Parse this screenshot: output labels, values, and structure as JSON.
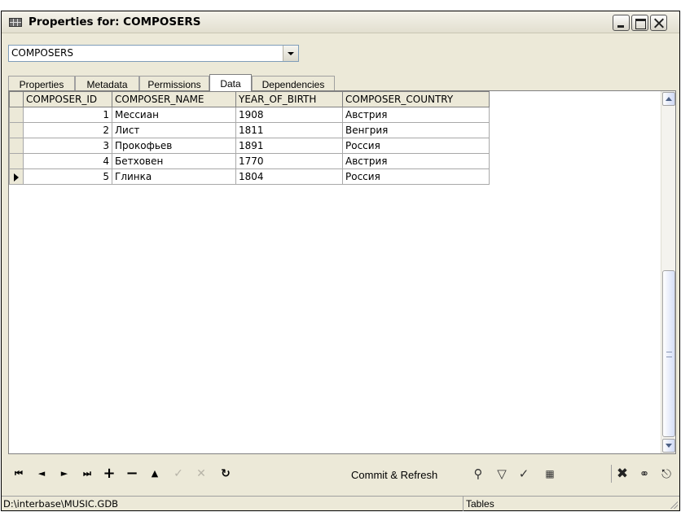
{
  "window": {
    "title": "Properties for: COMPOSERS"
  },
  "object_selector": {
    "value": "COMPOSERS"
  },
  "tabs": [
    {
      "label": "Properties"
    },
    {
      "label": "Metadata"
    },
    {
      "label": "Permissions"
    },
    {
      "label": "Data",
      "active": true
    },
    {
      "label": "Dependencies"
    }
  ],
  "grid": {
    "columns": [
      "COMPOSER_ID",
      "COMPOSER_NAME",
      "YEAR_OF_BIRTH",
      "COMPOSER_COUNTRY"
    ],
    "rows": [
      {
        "id": "1",
        "name": "Мессиан",
        "year": "1908",
        "country": "Австрия"
      },
      {
        "id": "2",
        "name": "Лист",
        "year": "1811",
        "country": "Венгрия"
      },
      {
        "id": "3",
        "name": "Прокофьев",
        "year": "1891",
        "country": "Россия"
      },
      {
        "id": "4",
        "name": "Бетховен",
        "year": "1770",
        "country": "Австрия"
      },
      {
        "id": "5",
        "name": "Глинка",
        "year": "1804",
        "country": "Россия"
      }
    ],
    "current_row_index": 4
  },
  "navigator": {
    "first": "⏮",
    "prior": "◄",
    "next": "►",
    "last": "⏭",
    "insert": "+",
    "delete": "−",
    "edit": "▲",
    "post": "✓",
    "cancel": "✕",
    "refresh": "↻",
    "commit_label": "Commit & Refresh",
    "icons": [
      "search-icon",
      "filter-icon",
      "clear-filter-icon",
      "grid-view-icon",
      "delete-all-icon",
      "export-icon",
      "import-icon"
    ]
  },
  "status": {
    "path": "D:\\interbase\\MUSIC.GDB",
    "section": "Tables"
  }
}
